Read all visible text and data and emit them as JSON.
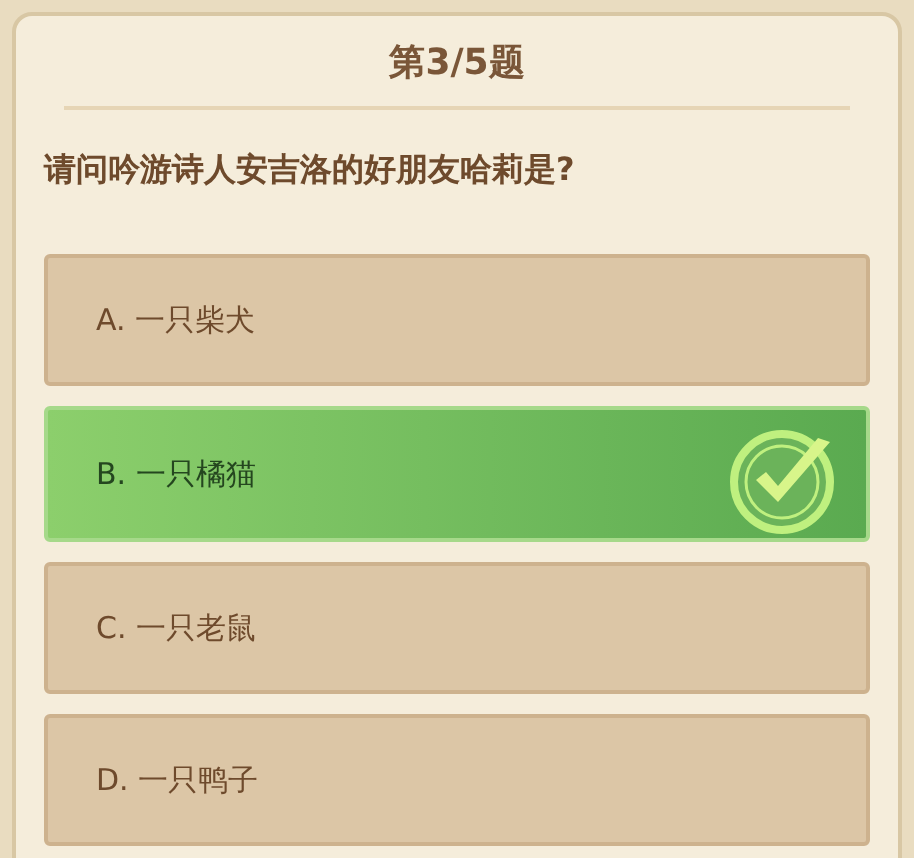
{
  "header": {
    "title": "第3/5题"
  },
  "question": "请问吟游诗人安吉洛的好朋友哈莉是?",
  "options": [
    {
      "label": "A. 一只柴犬",
      "selected": false
    },
    {
      "label": "B. 一只橘猫",
      "selected": true
    },
    {
      "label": "C. 一只老鼠",
      "selected": false
    },
    {
      "label": "D. 一只鸭子",
      "selected": false
    }
  ]
}
